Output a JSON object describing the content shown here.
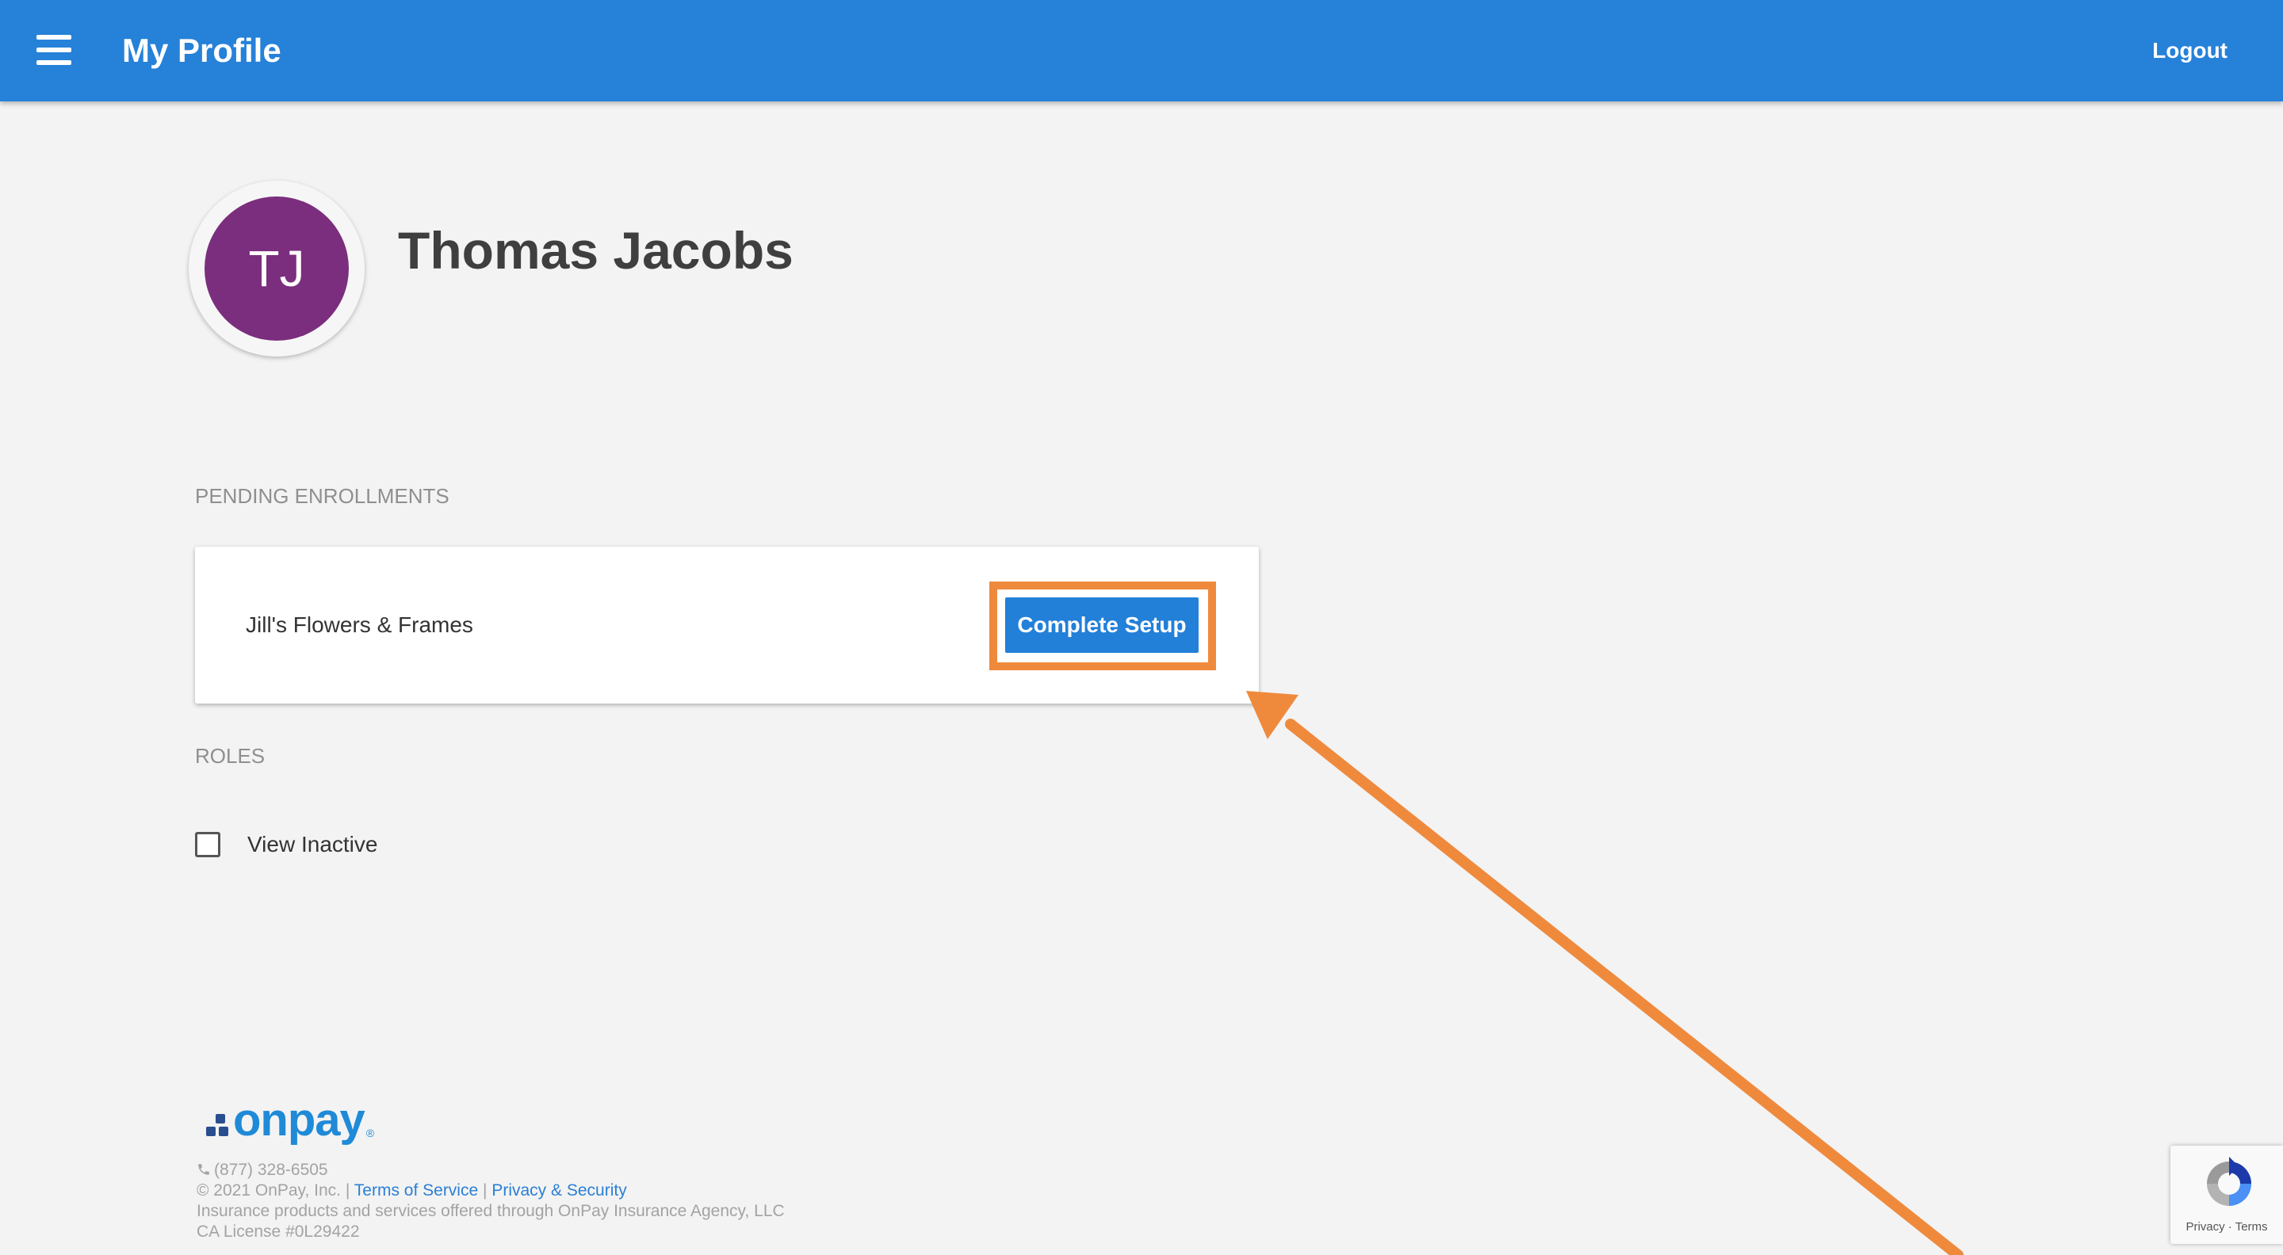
{
  "header": {
    "title": "My Profile",
    "logout_label": "Logout",
    "menu_icon": "hamburger-menu-icon"
  },
  "profile": {
    "initials": "TJ",
    "name": "Thomas Jacobs",
    "avatar_color": "#7b2e7d"
  },
  "pending_enrollments": {
    "heading": "PENDING ENROLLMENTS",
    "items": [
      {
        "company": "Jill's Flowers & Frames",
        "button_label": "Complete Setup"
      }
    ]
  },
  "roles": {
    "heading": "ROLES",
    "view_inactive_label": "View Inactive",
    "view_inactive_checked": false
  },
  "footer": {
    "logo_text": "onpay",
    "logo_mark": "®",
    "phone": "(877) 328-6505",
    "copyright": "© 2021 OnPay, Inc. |",
    "terms_link": "Terms of Service",
    "separator": "|",
    "privacy_link": "Privacy & Security",
    "insurance_note": "Insurance products and services offered through OnPay Insurance Agency, LLC",
    "license": "CA License #0L29422"
  },
  "recaptcha": {
    "privacy": "Privacy",
    "dot": "·",
    "terms": "Terms"
  },
  "colors": {
    "header": "#2681d9",
    "button": "#2280d8",
    "highlight": "#ef8a3d",
    "background": "#f3f3f3"
  }
}
